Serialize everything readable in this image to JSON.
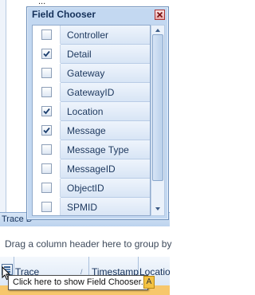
{
  "background": {
    "top_text": "...",
    "trace_bar_label": "Trace B",
    "group_hint": "Drag a column header here to group by",
    "columns": [
      "Trace",
      "Timestamp",
      "Location"
    ],
    "badge_letter": "A"
  },
  "field_chooser": {
    "title": "Field Chooser",
    "fields": [
      {
        "label": "Controller",
        "checked": false
      },
      {
        "label": "Detail",
        "checked": true
      },
      {
        "label": "Gateway",
        "checked": false
      },
      {
        "label": "GatewayID",
        "checked": false
      },
      {
        "label": "Location",
        "checked": true
      },
      {
        "label": "Message",
        "checked": true
      },
      {
        "label": "Message Type",
        "checked": false
      },
      {
        "label": "MessageID",
        "checked": false
      },
      {
        "label": "ObjectID",
        "checked": false
      },
      {
        "label": "SPMID",
        "checked": false
      }
    ]
  },
  "tooltip": {
    "text": "Click here to show Field Chooser."
  },
  "icons": {
    "close": "close-icon",
    "checkmark": "checkmark-icon",
    "field_chooser": "field-chooser-icon",
    "scroll_up": "scroll-up-icon",
    "scroll_down": "scroll-down-icon"
  },
  "colors": {
    "window_bg": "#c3d8f1",
    "header_gradient_top": "#f4f8fd",
    "accent_orange": "#f7c76b"
  }
}
